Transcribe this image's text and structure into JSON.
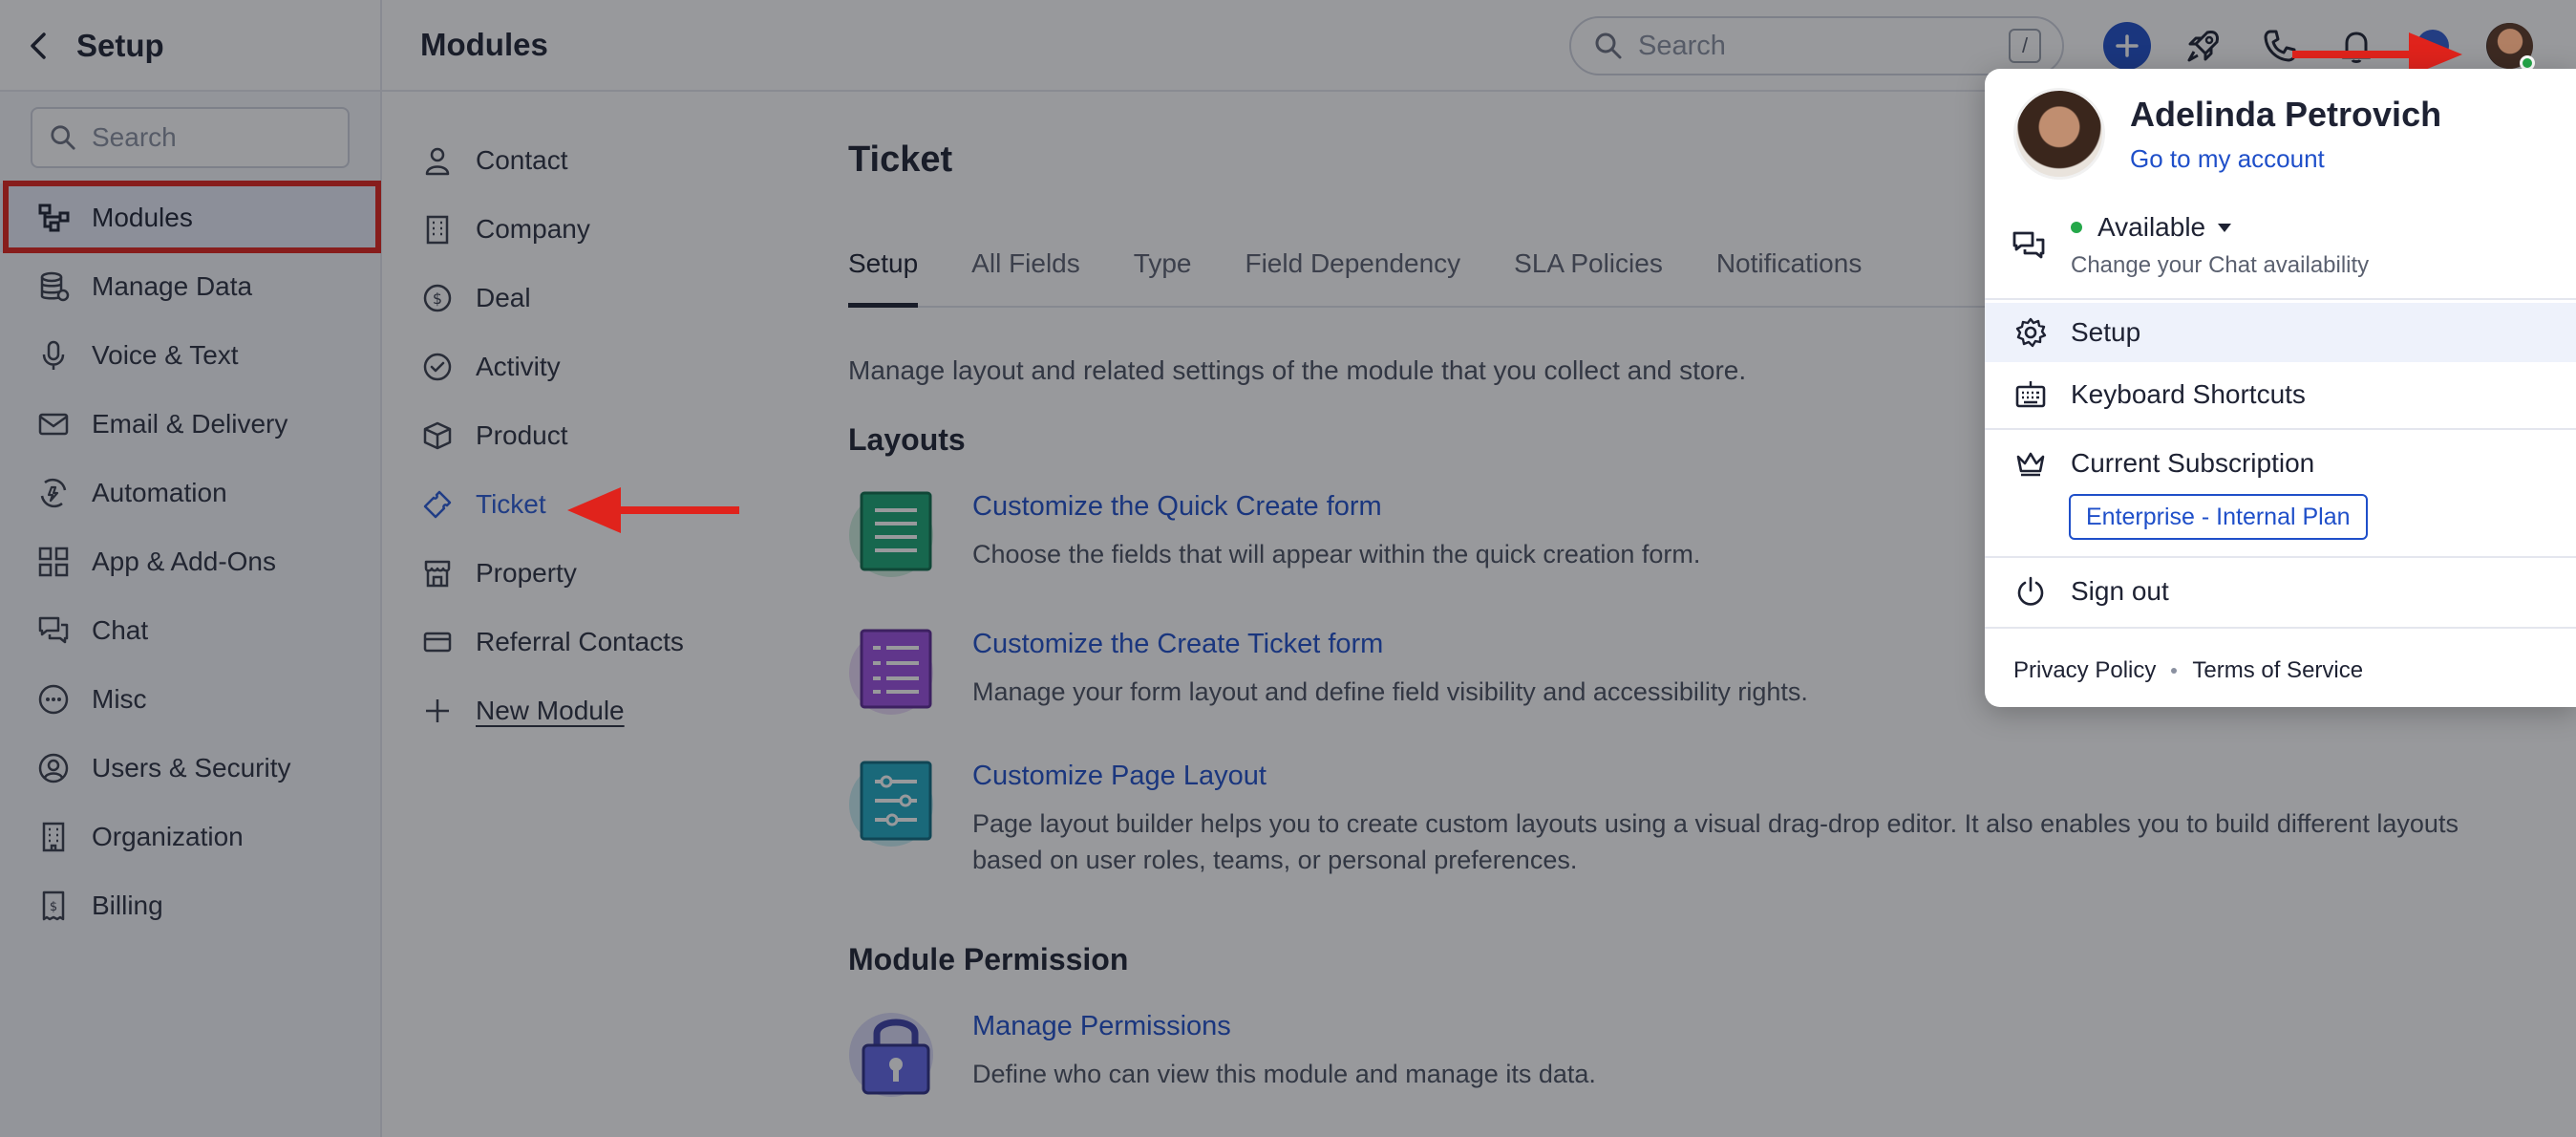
{
  "topbar": {
    "back_label": "Setup",
    "page_title": "Modules",
    "search_placeholder": "Search",
    "search_shortcut": "/"
  },
  "sidebar": {
    "search_placeholder": "Search",
    "items": [
      {
        "label": "Modules",
        "icon": "modules-icon",
        "active": true
      },
      {
        "label": "Manage Data",
        "icon": "database-icon"
      },
      {
        "label": "Voice & Text",
        "icon": "microphone-icon"
      },
      {
        "label": "Email & Delivery",
        "icon": "mail-icon"
      },
      {
        "label": "Automation",
        "icon": "automation-icon"
      },
      {
        "label": "App & Add-Ons",
        "icon": "apps-grid-icon"
      },
      {
        "label": "Chat",
        "icon": "chat-icon"
      },
      {
        "label": "Misc",
        "icon": "more-circle-icon"
      },
      {
        "label": "Users & Security",
        "icon": "user-circle-icon"
      },
      {
        "label": "Organization",
        "icon": "building-icon"
      },
      {
        "label": "Billing",
        "icon": "receipt-icon"
      }
    ]
  },
  "modules": {
    "items": [
      {
        "label": "Contact",
        "icon": "person-icon"
      },
      {
        "label": "Company",
        "icon": "company-icon"
      },
      {
        "label": "Deal",
        "icon": "dollar-circle-icon"
      },
      {
        "label": "Activity",
        "icon": "check-circle-icon"
      },
      {
        "label": "Product",
        "icon": "box-icon"
      },
      {
        "label": "Ticket",
        "icon": "ticket-icon",
        "active": true
      },
      {
        "label": "Property",
        "icon": "storefront-icon"
      },
      {
        "label": "Referral Contacts",
        "icon": "card-icon"
      },
      {
        "label": "New Module",
        "icon": "plus-icon"
      }
    ]
  },
  "main": {
    "title": "Ticket",
    "tabs": [
      "Setup",
      "All Fields",
      "Type",
      "Field Dependency",
      "SLA Policies",
      "Notifications"
    ],
    "active_tab": "Setup",
    "description": "Manage layout and related settings of the module that you collect and store.",
    "layouts_title": "Layouts",
    "features": [
      {
        "title": "Customize the Quick Create form",
        "desc": "Choose the fields that will appear within the quick creation form."
      },
      {
        "title": "Customize the Create Ticket form",
        "desc": "Manage your form layout and define field visibility and accessibility rights."
      },
      {
        "title": "Customize Page Layout",
        "desc": "Page layout builder helps you to create custom layouts using a visual drag-drop editor. It also enables you to build different layouts based on user roles, teams, or personal preferences."
      }
    ],
    "permission_title": "Module Permission",
    "permission": {
      "title": "Manage Permissions",
      "desc": "Define who can view this module and manage its data."
    }
  },
  "profile_menu": {
    "name": "Adelinda Petrovich",
    "account_link": "Go to my account",
    "status": "Available",
    "status_hint": "Change your Chat availability",
    "setup": "Setup",
    "shortcuts": "Keyboard Shortcuts",
    "subscription": "Current Subscription",
    "plan": "Enterprise - Internal Plan",
    "sign_out": "Sign out",
    "privacy": "Privacy Policy",
    "terms": "Terms of Service"
  },
  "colors": {
    "accent": "#1f4fc9",
    "annotation": "#e0231c",
    "online": "#25a84a"
  }
}
